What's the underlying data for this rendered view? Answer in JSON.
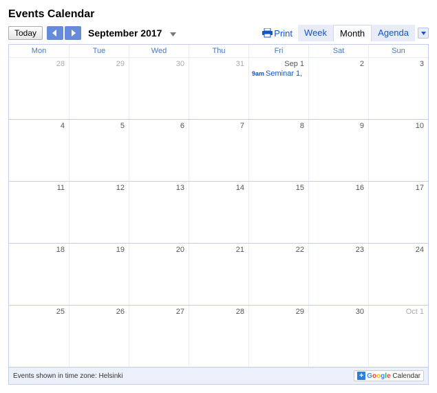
{
  "title": "Events Calendar",
  "today_label": "Today",
  "period": "September 2017",
  "print_label": "Print",
  "views": {
    "week": "Week",
    "month": "Month",
    "agenda": "Agenda",
    "active": "month"
  },
  "day_headers": [
    "Mon",
    "Tue",
    "Wed",
    "Thu",
    "Fri",
    "Sat",
    "Sun"
  ],
  "weeks": [
    [
      {
        "num": "28",
        "other": true
      },
      {
        "num": "29",
        "other": true
      },
      {
        "num": "30",
        "other": true
      },
      {
        "num": "31",
        "other": true
      },
      {
        "num": "Sep 1",
        "events": [
          {
            "time": "9am",
            "title": "Seminar 1,"
          }
        ]
      },
      {
        "num": "2"
      },
      {
        "num": "3"
      }
    ],
    [
      {
        "num": "4"
      },
      {
        "num": "5"
      },
      {
        "num": "6"
      },
      {
        "num": "7"
      },
      {
        "num": "8"
      },
      {
        "num": "9"
      },
      {
        "num": "10"
      }
    ],
    [
      {
        "num": "11"
      },
      {
        "num": "12"
      },
      {
        "num": "13"
      },
      {
        "num": "14"
      },
      {
        "num": "15"
      },
      {
        "num": "16"
      },
      {
        "num": "17"
      }
    ],
    [
      {
        "num": "18"
      },
      {
        "num": "19"
      },
      {
        "num": "20"
      },
      {
        "num": "21"
      },
      {
        "num": "22"
      },
      {
        "num": "23"
      },
      {
        "num": "24"
      }
    ],
    [
      {
        "num": "25"
      },
      {
        "num": "26"
      },
      {
        "num": "27"
      },
      {
        "num": "28"
      },
      {
        "num": "29"
      },
      {
        "num": "30"
      },
      {
        "num": "Oct 1",
        "other": true
      }
    ]
  ],
  "timezone_text": "Events shown in time zone: Helsinki",
  "gcal": {
    "brand": "Google",
    "product": "Calendar"
  }
}
